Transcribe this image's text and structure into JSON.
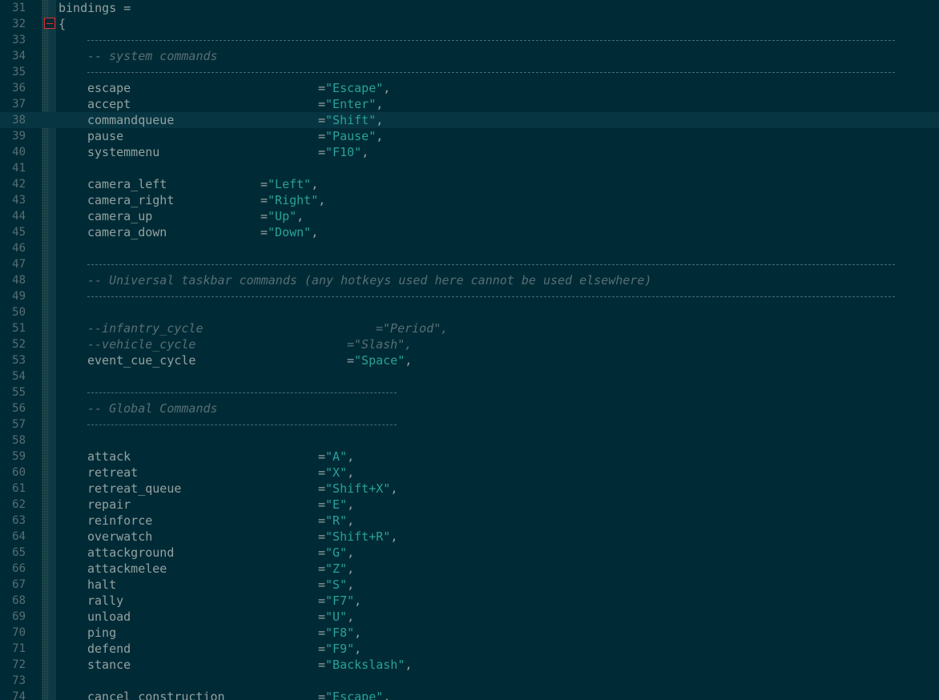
{
  "editor": {
    "colors": {
      "background": "#002b36",
      "current_line": "#073642",
      "text": "#93a1a1",
      "string": "#2aa198",
      "comment": "#586e75",
      "line_number": "#586e75",
      "fold_marker": "#dc322f"
    },
    "lines": [
      {
        "n": "31",
        "text": "bindings ="
      },
      {
        "n": "32",
        "text": "{"
      },
      {
        "n": "33"
      },
      {
        "n": "34",
        "comment": "-- system commands"
      },
      {
        "n": "35"
      },
      {
        "n": "36",
        "key": "escape",
        "value": "\"Escape\""
      },
      {
        "n": "37",
        "key": "accept",
        "value": "\"Enter\""
      },
      {
        "n": "38",
        "key": "commandqueue",
        "value": "\"Shift\""
      },
      {
        "n": "39",
        "key": "pause",
        "value": "\"Pause\""
      },
      {
        "n": "40",
        "key": "systemmenu",
        "value": "\"F10\""
      },
      {
        "n": "41"
      },
      {
        "n": "42",
        "key": "camera_left",
        "value": "\"Left\""
      },
      {
        "n": "43",
        "key": "camera_right",
        "value": "\"Right\""
      },
      {
        "n": "44",
        "key": "camera_up",
        "value": "\"Up\""
      },
      {
        "n": "45",
        "key": "camera_down",
        "value": "\"Down\""
      },
      {
        "n": "46"
      },
      {
        "n": "47"
      },
      {
        "n": "48",
        "comment": "-- Universal taskbar commands (any hotkeys used here cannot be used elsewhere)"
      },
      {
        "n": "49"
      },
      {
        "n": "50"
      },
      {
        "n": "51",
        "ckey": "--infantry_cycle",
        "cvalue": "=\"Period\","
      },
      {
        "n": "52",
        "ckey": "--vehicle_cycle",
        "cvalue": "=\"Slash\","
      },
      {
        "n": "53",
        "key": "event_cue_cycle",
        "value": "\"Space\""
      },
      {
        "n": "54"
      },
      {
        "n": "55"
      },
      {
        "n": "56",
        "comment": "-- Global Commands"
      },
      {
        "n": "57"
      },
      {
        "n": "58"
      },
      {
        "n": "59",
        "key": "attack",
        "value": "\"A\""
      },
      {
        "n": "60",
        "key": "retreat",
        "value": "\"X\""
      },
      {
        "n": "61",
        "key": "retreat_queue",
        "value": "\"Shift+X\""
      },
      {
        "n": "62",
        "key": "repair",
        "value": "\"E\""
      },
      {
        "n": "63",
        "key": "reinforce",
        "value": "\"R\""
      },
      {
        "n": "64",
        "key": "overwatch",
        "value": "\"Shift+R\""
      },
      {
        "n": "65",
        "key": "attackground",
        "value": "\"G\""
      },
      {
        "n": "66",
        "key": "attackmelee",
        "value": "\"Z\""
      },
      {
        "n": "67",
        "key": "halt",
        "value": "\"S\""
      },
      {
        "n": "68",
        "key": "rally",
        "value": "\"F7\""
      },
      {
        "n": "69",
        "key": "unload",
        "value": "\"U\""
      },
      {
        "n": "70",
        "key": "ping",
        "value": "\"F8\""
      },
      {
        "n": "71",
        "key": "defend",
        "value": "\"F9\""
      },
      {
        "n": "72",
        "key": "stance",
        "value": "\"Backslash\""
      },
      {
        "n": "73"
      },
      {
        "n": "74",
        "key": "cancel_construction",
        "value": "\"Escape\""
      }
    ]
  }
}
